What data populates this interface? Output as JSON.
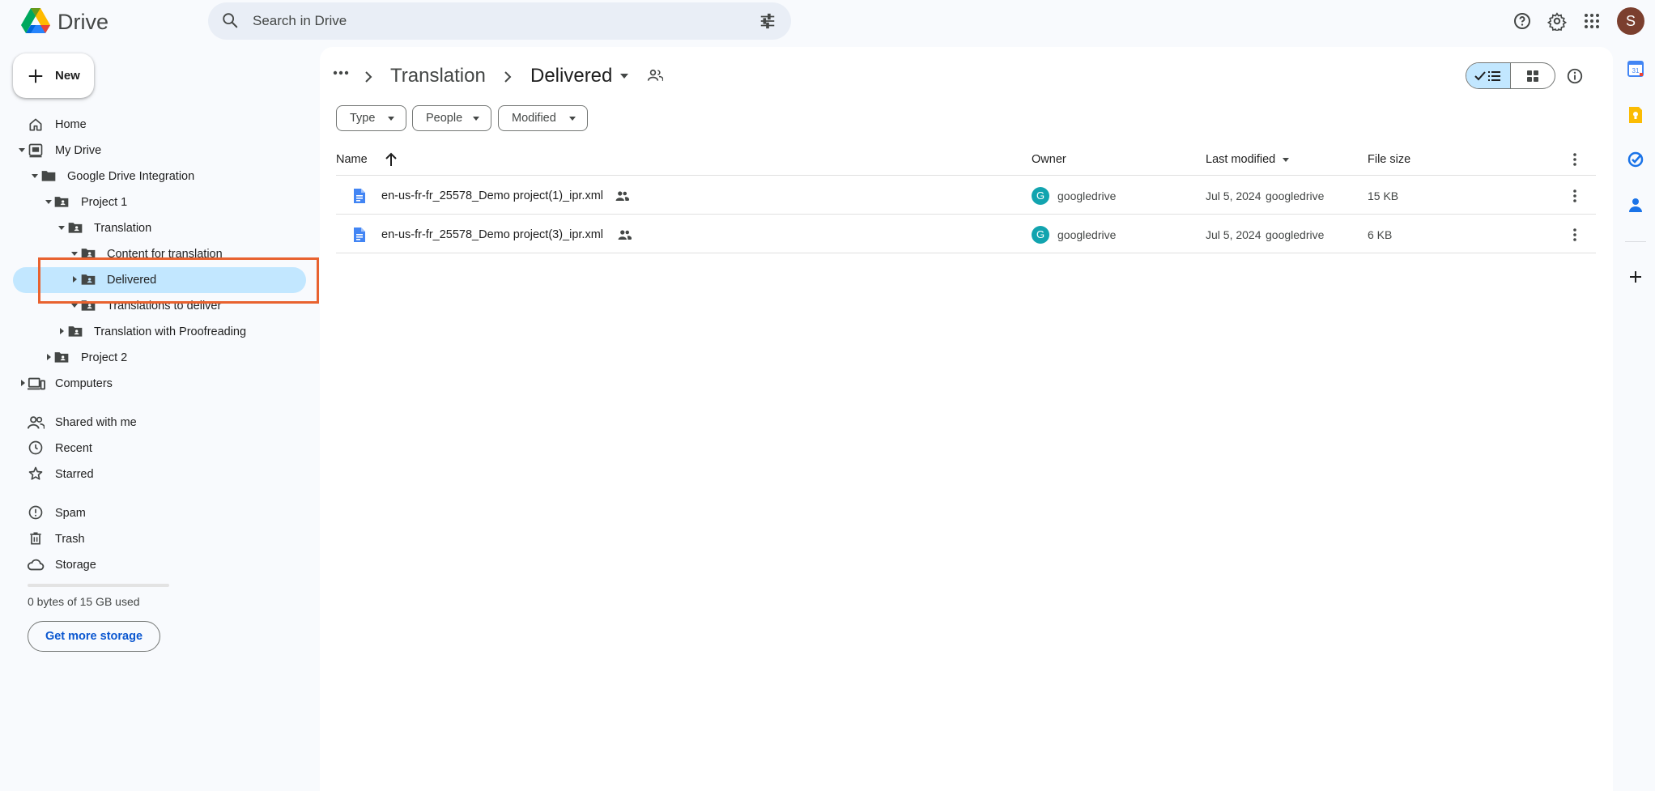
{
  "app": {
    "name": "Drive",
    "avatar_letter": "S"
  },
  "search": {
    "placeholder": "Search in Drive"
  },
  "new_button": {
    "label": "New"
  },
  "sidebar": {
    "home": "Home",
    "my_drive": "My Drive",
    "tree": {
      "google_drive_integration": "Google Drive Integration",
      "project_1": "Project 1",
      "translation": "Translation",
      "content_for_translation": "Content for translation",
      "delivered": "Delivered",
      "translations_to_deliver": "Translations to deliver",
      "translation_with_proofreading": "Translation with Proofreading",
      "project_2": "Project 2"
    },
    "computers": "Computers",
    "shared_with_me": "Shared with me",
    "recent": "Recent",
    "starred": "Starred",
    "spam": "Spam",
    "trash": "Trash",
    "storage": "Storage",
    "storage_used_text": "0 bytes of 15 GB used",
    "storage_used_fraction": 0,
    "get_more_storage": "Get more storage"
  },
  "breadcrumb": {
    "parent": "Translation",
    "current": "Delivered"
  },
  "filters": {
    "type": "Type",
    "people": "People",
    "modified": "Modified"
  },
  "table": {
    "headers": {
      "name": "Name",
      "owner": "Owner",
      "last_modified": "Last modified",
      "file_size": "File size"
    },
    "rows": [
      {
        "name": "en-us-fr-fr_25578_Demo project(1)_ipr.xml",
        "owner_initial": "G",
        "owner": "googledrive",
        "modified_date": "Jul 5, 2024",
        "modified_by": "googledrive",
        "size": "15 KB"
      },
      {
        "name": "en-us-fr-fr_25578_Demo project(3)_ipr.xml",
        "owner_initial": "G",
        "owner": "googledrive",
        "modified_date": "Jul 5, 2024",
        "modified_by": "googledrive",
        "size": "6 KB"
      }
    ]
  },
  "side_panel": {
    "calendar_day": "31"
  },
  "colors": {
    "accent_blue": "#0b57d0",
    "selected_bg": "#c2e7ff",
    "highlight_box": "#e8622f",
    "owner_badge": "#12a4af",
    "doc_icon": "#4285f4"
  }
}
